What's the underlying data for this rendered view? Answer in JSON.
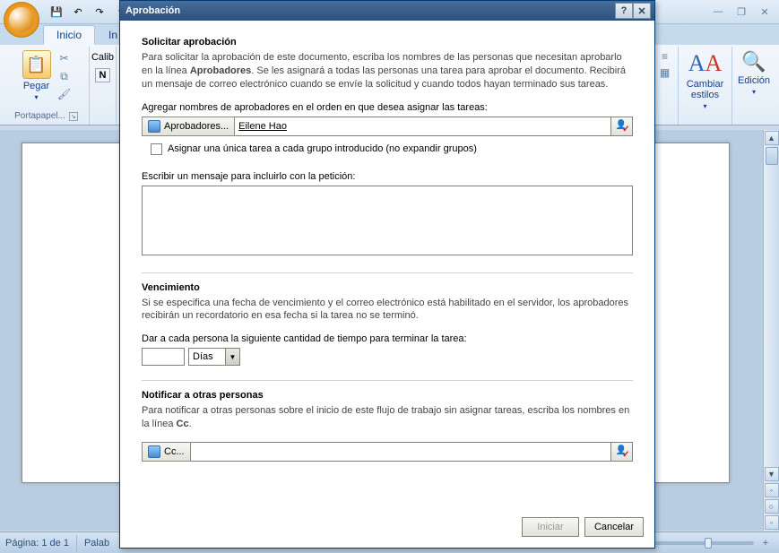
{
  "window": {
    "qat": {
      "save": "💾",
      "undo": "↶",
      "redo": "↷"
    },
    "controls": {
      "min": "—",
      "restore": "❐",
      "close": "✕"
    }
  },
  "tabs": {
    "inicio": "Inicio",
    "in": "In"
  },
  "ribbon": {
    "clipboard": {
      "paste": "Pegar",
      "group": "Portapapel..."
    },
    "font": {
      "family_prefix": "Calib",
      "bold": "N"
    },
    "styles": {
      "label": "Cambiar estilos",
      "sample": "AA"
    },
    "edit": {
      "label": "Edición"
    }
  },
  "status": {
    "page": "Página: 1 de 1",
    "words_prefix": "Palab"
  },
  "dialog": {
    "title": "Aprobación",
    "help": "?",
    "close": "✕",
    "section1_title": "Solicitar aprobación",
    "section1_text_a": "Para solicitar la aprobación de este documento, escriba los nombres de las personas que necesitan aprobarlo en la línea ",
    "section1_text_bold": "Aprobadores",
    "section1_text_b": ".  Se les asignará a todas las personas una tarea para aprobar el documento. Recibirá un mensaje de correo electrónico cuando se envíe la solicitud y cuando todos hayan terminado sus tareas.",
    "add_approvers_label": "Agregar nombres de aprobadores en el orden en que desea asignar las tareas:",
    "approvers_btn": "Aprobadores...",
    "approvers_value": "Eilene Hao",
    "assign_single_task": "Asignar una única tarea a cada grupo introducido (no expandir grupos)",
    "message_label": "Escribir un mensaje para incluirlo con la petición:",
    "message_value": "",
    "section2_title": "Vencimiento",
    "section2_text": "Si se especifica una fecha de vencimiento y el correo electrónico está habilitado en el servidor, los aprobadores recibirán un recordatorio en esa fecha si la tarea no se terminó.",
    "time_label": "Dar a cada persona la siguiente cantidad de tiempo para terminar la tarea:",
    "time_value": "",
    "time_unit": "Días",
    "section3_title": "Notificar a otras personas",
    "section3_text_a": "Para notificar a otras personas sobre el inicio de este flujo de trabajo sin asignar tareas, escriba los nombres en la línea ",
    "section3_text_bold": "Cc",
    "section3_text_b": ".",
    "cc_btn": "Cc...",
    "cc_value": "",
    "start_btn": "Iniciar",
    "cancel_btn": "Cancelar"
  }
}
